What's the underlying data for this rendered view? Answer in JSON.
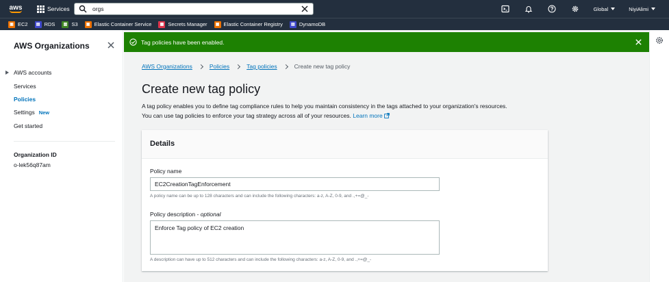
{
  "nav": {
    "logo_text": "aws",
    "services_label": "Services",
    "search_value": "orgs",
    "region_label": "Global",
    "user_label": "NiyiAlimi",
    "icons": [
      "cloudshell-icon",
      "bell-icon",
      "help-icon",
      "gear-icon"
    ]
  },
  "favorites": [
    {
      "label": "EC2",
      "color": "#ed7100",
      "glyph": "▣"
    },
    {
      "label": "RDS",
      "color": "#3f48cc",
      "glyph": "▤"
    },
    {
      "label": "S3",
      "color": "#3f8624",
      "glyph": "▥"
    },
    {
      "label": "Elastic Container Service",
      "color": "#ed7100",
      "glyph": "▣"
    },
    {
      "label": "Secrets Manager",
      "color": "#dd344c",
      "glyph": "▦"
    },
    {
      "label": "Elastic Container Registry",
      "color": "#ed7100",
      "glyph": "▣"
    },
    {
      "label": "DynamoDB",
      "color": "#3f48cc",
      "glyph": "▤"
    }
  ],
  "sidebar": {
    "title": "AWS Organizations",
    "items": [
      {
        "label": "AWS accounts"
      },
      {
        "label": "Services"
      },
      {
        "label": "Policies"
      },
      {
        "label": "Settings",
        "badge": "New"
      },
      {
        "label": "Get started"
      }
    ],
    "org_id_label": "Organization ID",
    "org_id_value": "o-lek56q87am"
  },
  "flash": {
    "message": "Tag policies have been enabled.",
    "color": "#1d8102"
  },
  "breadcrumb": {
    "items": [
      "AWS Organizations",
      "Policies",
      "Tag policies"
    ],
    "current": "Create new tag policy"
  },
  "page": {
    "title": "Create new tag policy",
    "description_line1": "A tag policy enables you to define tag compliance rules to help you maintain consistency in the tags attached to your organization's resources.",
    "description_line2": "You can use tag policies to enforce your tag strategy across all of your resources.",
    "learn_more": "Learn more"
  },
  "details": {
    "title": "Details",
    "policy_name_label": "Policy name",
    "policy_name_value": "EC2CreationTagEnforcement",
    "policy_name_hint": "A policy name can be up to 128 characters and can include the following characters: a-z, A-Z, 0-9, and .,+=@_-",
    "policy_desc_label": "Policy description",
    "policy_desc_optional": "optional",
    "policy_desc_value": "Enforce Tag policy of EC2 creation",
    "policy_desc_hint": "A description can have up to 512 characters and can include the following characters: a-z, A-Z, 0-9, and .,+=@_-"
  },
  "colors": {
    "nav_bg": "#232f3e",
    "link": "#0073bb",
    "accent": "#ff9900"
  }
}
